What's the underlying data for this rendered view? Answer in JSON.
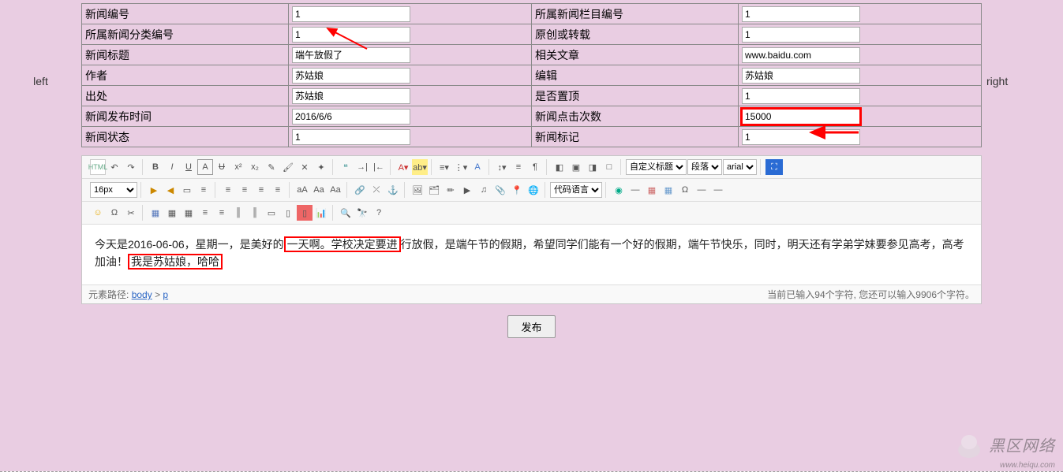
{
  "side": {
    "left": "left",
    "right": "right"
  },
  "form": {
    "rows": [
      {
        "l1": "新闻编号",
        "v1": "1",
        "l2": "所属新闻栏目编号",
        "v2": "1"
      },
      {
        "l1": "所属新闻分类编号",
        "v1": "1",
        "l2": "原创或转载",
        "v2": "1"
      },
      {
        "l1": "新闻标题",
        "v1": "端午放假了",
        "l2": "相关文章",
        "v2": "www.baidu.com"
      },
      {
        "l1": "作者",
        "v1": "苏姑娘",
        "l2": "编辑",
        "v2": "苏姑娘"
      },
      {
        "l1": "出处",
        "v1": "苏姑娘",
        "l2": "是否置顶",
        "v2": "1"
      },
      {
        "l1": "新闻发布时间",
        "v1": "2016/6/6",
        "l2": "新闻点击次数",
        "v2": "15000",
        "v2_hl": true
      },
      {
        "l1": "新闻状态",
        "v1": "1",
        "l2": "新闻标记",
        "v2": "1"
      }
    ]
  },
  "toolbar": {
    "html": "HTML",
    "custom_title": "自定义标题",
    "paragraph": "段落",
    "font": "arial",
    "size": "16px",
    "code_lang": "代码语言"
  },
  "content": {
    "pre": "今天是2016-06-06，星期一，是美好的",
    "box_top": "一天啊。学校决定要进",
    "mid": "行放假，是端午节的假期，希望同学们能有一个好的假期，端午节快乐，同时，明天还有学弟学妹要参见高考，高考加油！",
    "box_bottom": "我是苏姑娘，哈哈"
  },
  "status": {
    "path_label": "元素路径:",
    "path_body": "body",
    "path_sep": ">",
    "path_p": "p",
    "counter": "当前已输入94个字符, 您还可以输入9906个字符。"
  },
  "publish": "发布",
  "watermark": {
    "big": "黑区网络",
    "small": "www.heiqu.com"
  }
}
